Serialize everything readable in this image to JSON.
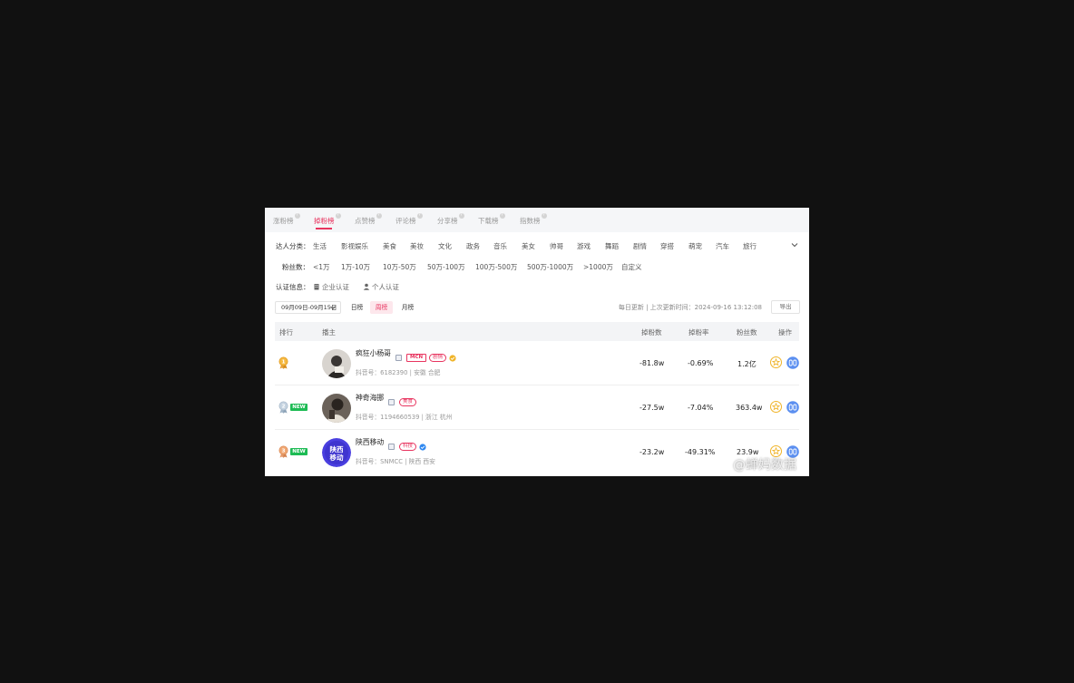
{
  "tabs": [
    {
      "label": "涨粉榜",
      "active": false
    },
    {
      "label": "掉粉榜",
      "active": true
    },
    {
      "label": "点赞榜",
      "active": false
    },
    {
      "label": "评论榜",
      "active": false
    },
    {
      "label": "分享榜",
      "active": false
    },
    {
      "label": "下载榜",
      "active": false
    },
    {
      "label": "指数榜",
      "active": false
    }
  ],
  "tab_help_glyph": "?",
  "filters": {
    "category_label": "达人分类：",
    "categories": [
      "生活",
      "影视娱乐",
      "美食",
      "美妆",
      "文化",
      "政务",
      "音乐",
      "美女",
      "帅哥",
      "游戏",
      "舞蹈",
      "剧情",
      "穿搭",
      "萌宠",
      "汽车",
      "旅行"
    ],
    "fans_label": "粉丝数：",
    "fans_ranges": [
      "<1万",
      "1万-10万",
      "10万-50万",
      "50万-100万",
      "100万-500万",
      "500万-1000万",
      ">1000万",
      "自定义"
    ],
    "cert_label": "认证信息：",
    "cert_options": [
      "企业认证",
      "个人认证"
    ]
  },
  "toolbar": {
    "date_range": "09月09日-09月15日",
    "periods": [
      {
        "label": "日榜",
        "active": false
      },
      {
        "label": "周榜",
        "active": true
      },
      {
        "label": "月榜",
        "active": false
      }
    ],
    "update_info": "每日更新 | 上次更新时间：2024-09-16 13:12:08",
    "export_label": "导出"
  },
  "table": {
    "headers": {
      "rank": "排行",
      "host": "播主",
      "lost_fans": "掉粉数",
      "lost_rate": "掉粉率",
      "fans": "粉丝数",
      "ops": "操作"
    },
    "rows": [
      {
        "rank": 1,
        "medal": "gold",
        "is_new": false,
        "new_label": "",
        "name": "疯狂小杨哥",
        "tags": [
          "MCN",
          "剧情"
        ],
        "verified": "gold",
        "account": "抖音号：6182390 | 安徽 合肥",
        "lost_fans": "-81.8w",
        "lost_rate": "-0.69%",
        "fans": "1.2亿"
      },
      {
        "rank": 2,
        "medal": "silver",
        "is_new": true,
        "new_label": "NEW",
        "name": "神奇海挪",
        "tags": [
          "美食"
        ],
        "verified": "",
        "account": "抖音号：1194660539 | 浙江 杭州",
        "lost_fans": "-27.5w",
        "lost_rate": "-7.04%",
        "fans": "363.4w"
      },
      {
        "rank": 3,
        "medal": "bronze",
        "is_new": true,
        "new_label": "NEW",
        "name": "陕西移动",
        "tags": [
          "科技"
        ],
        "verified": "blue",
        "account": "抖音号：SNMCC | 陕西 西安",
        "lost_fans": "-23.2w",
        "lost_rate": "-49.31%",
        "fans": "23.9w",
        "avatar_text": "陕西移动"
      }
    ]
  },
  "watermark": "@蝉妈数据",
  "colors": {
    "accent": "#e8345f",
    "new_badge": "#1dbb54",
    "gold": "#f0b429",
    "blue_verify": "#2f88f0"
  }
}
